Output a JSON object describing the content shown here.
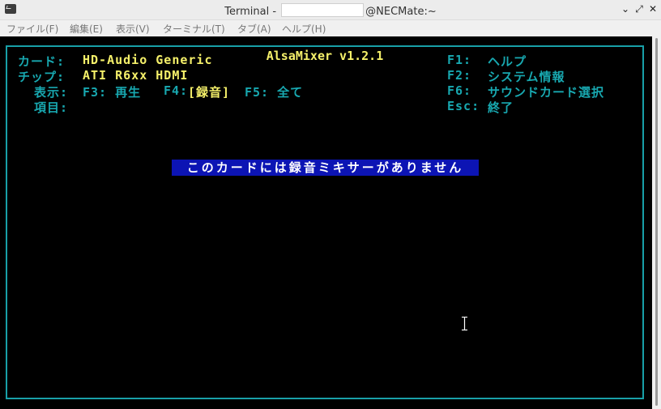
{
  "window": {
    "title_prefix": "Terminal - ",
    "title_suffix": "@NECMate:~",
    "buttons": [
      "minimize-icon",
      "maximize-icon",
      "close-icon"
    ]
  },
  "menu": {
    "items": [
      "ファイル(F)",
      "編集(E)",
      "表示(V)",
      "ターミナル(T)",
      "タブ(A)",
      "ヘルプ(H)"
    ]
  },
  "alsamixer": {
    "title": "AlsaMixer v1.2.1",
    "card_label": "カード:",
    "card_value": "HD-Audio Generic",
    "chip_label": "チップ:",
    "chip_value": "ATI R6xx HDMI",
    "view_label": "表示:",
    "view_f3": "F3: 再生",
    "view_f4_key": "F4:",
    "view_f4_value": "[録音]",
    "view_f5": "F5: 全て",
    "item_label": "項目:",
    "help_f1_key": "F1:",
    "help_f1_value": "ヘルプ",
    "help_f2_key": "F2:",
    "help_f2_value": "システム情報",
    "help_f6_key": "F6:",
    "help_f6_value": "サウンドカード選択",
    "help_esc_key": "Esc:",
    "help_esc_value": "終了",
    "message": "このカードには録音ミキサーがありません"
  },
  "colors": {
    "frame": "#18a0a8",
    "label": "#18a8b0",
    "value": "#f5f06a",
    "message_bg": "#0c14b4"
  }
}
